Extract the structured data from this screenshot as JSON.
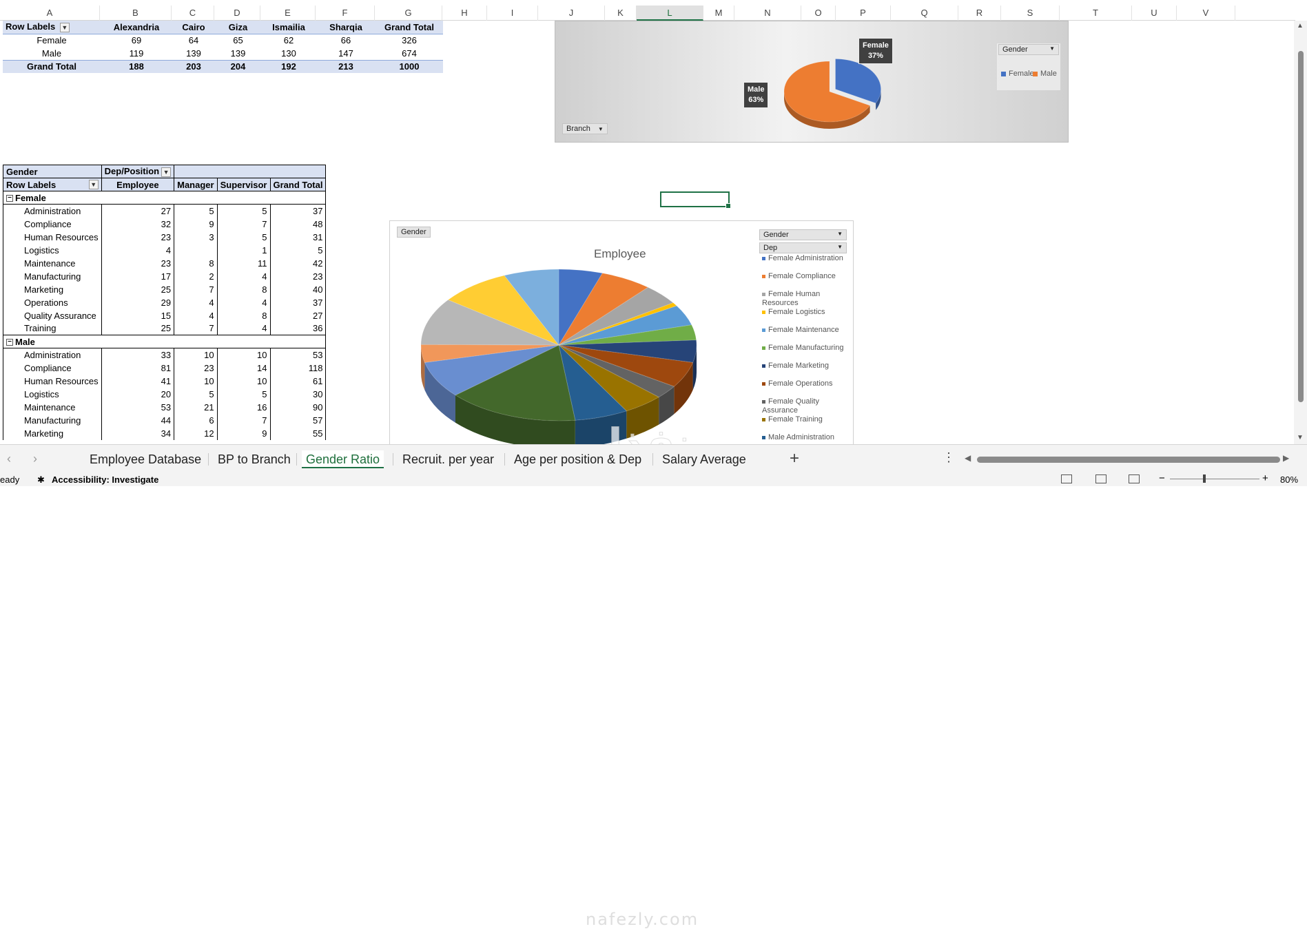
{
  "columns": [
    "A",
    "B",
    "C",
    "D",
    "E",
    "F",
    "G",
    "H",
    "I",
    "J",
    "K",
    "L",
    "M",
    "N",
    "O",
    "P",
    "Q",
    "R",
    "S",
    "T",
    "U",
    "V"
  ],
  "pivot1": {
    "headers": [
      "Row Labels",
      "Alexandria",
      "Cairo",
      "Giza",
      "Ismailia",
      "Sharqia",
      "Grand Total"
    ],
    "rows": [
      [
        "Female",
        "69",
        "64",
        "65",
        "62",
        "66",
        "326"
      ],
      [
        "Male",
        "119",
        "139",
        "139",
        "130",
        "147",
        "674"
      ]
    ],
    "total": [
      "Grand Total",
      "188",
      "203",
      "204",
      "192",
      "213",
      "1000"
    ]
  },
  "pivot2": {
    "filter_label": "Gender",
    "col_field": "Dep/Position",
    "headers": [
      "Row Labels",
      "Employee",
      "Manager",
      "Supervisor",
      "Grand Total"
    ],
    "groups": [
      {
        "name": "Female",
        "rows": [
          [
            "Administration",
            "27",
            "5",
            "5",
            "37"
          ],
          [
            "Compliance",
            "32",
            "9",
            "7",
            "48"
          ],
          [
            "Human Resources",
            "23",
            "3",
            "5",
            "31"
          ],
          [
            "Logistics",
            "4",
            "",
            "1",
            "5"
          ],
          [
            "Maintenance",
            "23",
            "8",
            "11",
            "42"
          ],
          [
            "Manufacturing",
            "17",
            "2",
            "4",
            "23"
          ],
          [
            "Marketing",
            "25",
            "7",
            "8",
            "40"
          ],
          [
            "Operations",
            "29",
            "4",
            "4",
            "37"
          ],
          [
            "Quality Assurance",
            "15",
            "4",
            "8",
            "27"
          ],
          [
            "Training",
            "25",
            "7",
            "4",
            "36"
          ]
        ]
      },
      {
        "name": "Male",
        "rows": [
          [
            "Administration",
            "33",
            "10",
            "10",
            "53"
          ],
          [
            "Compliance",
            "81",
            "23",
            "14",
            "118"
          ],
          [
            "Human Resources",
            "41",
            "10",
            "10",
            "61"
          ],
          [
            "Logistics",
            "20",
            "5",
            "5",
            "30"
          ],
          [
            "Maintenance",
            "53",
            "21",
            "16",
            "90"
          ],
          [
            "Manufacturing",
            "44",
            "6",
            "7",
            "57"
          ],
          [
            "Marketing",
            "34",
            "12",
            "9",
            "55"
          ]
        ]
      }
    ]
  },
  "chart1": {
    "field_buttons": {
      "legend_filter": "Gender",
      "axis_filter": "Branch"
    },
    "labels": [
      {
        "name": "Female",
        "pct": "37%"
      },
      {
        "name": "Male",
        "pct": "63%"
      }
    ],
    "legend": [
      "Female",
      "Male"
    ],
    "colors": {
      "female": "#4472c4",
      "male": "#ed7d31"
    }
  },
  "chart2": {
    "title": "Employee",
    "field_buttons": {
      "values": "Gender",
      "legend1": "Gender",
      "legend2": "Dep"
    },
    "legend": [
      "Female Administration",
      "Female Compliance",
      "Female Human Resources",
      "Female Logistics",
      "Female Maintenance",
      "Female Manufacturing",
      "Female Marketing",
      "Female Operations",
      "Female Quality Assurance",
      "Female Training",
      "Male Administration"
    ],
    "legend_colors": [
      "#4472c4",
      "#ed7d31",
      "#a5a5a5",
      "#ffc000",
      "#5b9bd5",
      "#70ad47",
      "#264478",
      "#9e480e",
      "#636363",
      "#997300",
      "#255e91"
    ]
  },
  "sheet_tabs": [
    "Employee Database",
    "BP to Branch",
    "Gender Ratio",
    "Recruit. per year",
    "Age per position & Dep",
    "Salary Average"
  ],
  "active_tab": "Gender Ratio",
  "status": {
    "ready": "eady",
    "accessibility": "Accessibility: Investigate",
    "zoom": "80%"
  },
  "watermark": {
    "arabic": "نفذلي",
    "latin": "nafezly.com"
  }
}
